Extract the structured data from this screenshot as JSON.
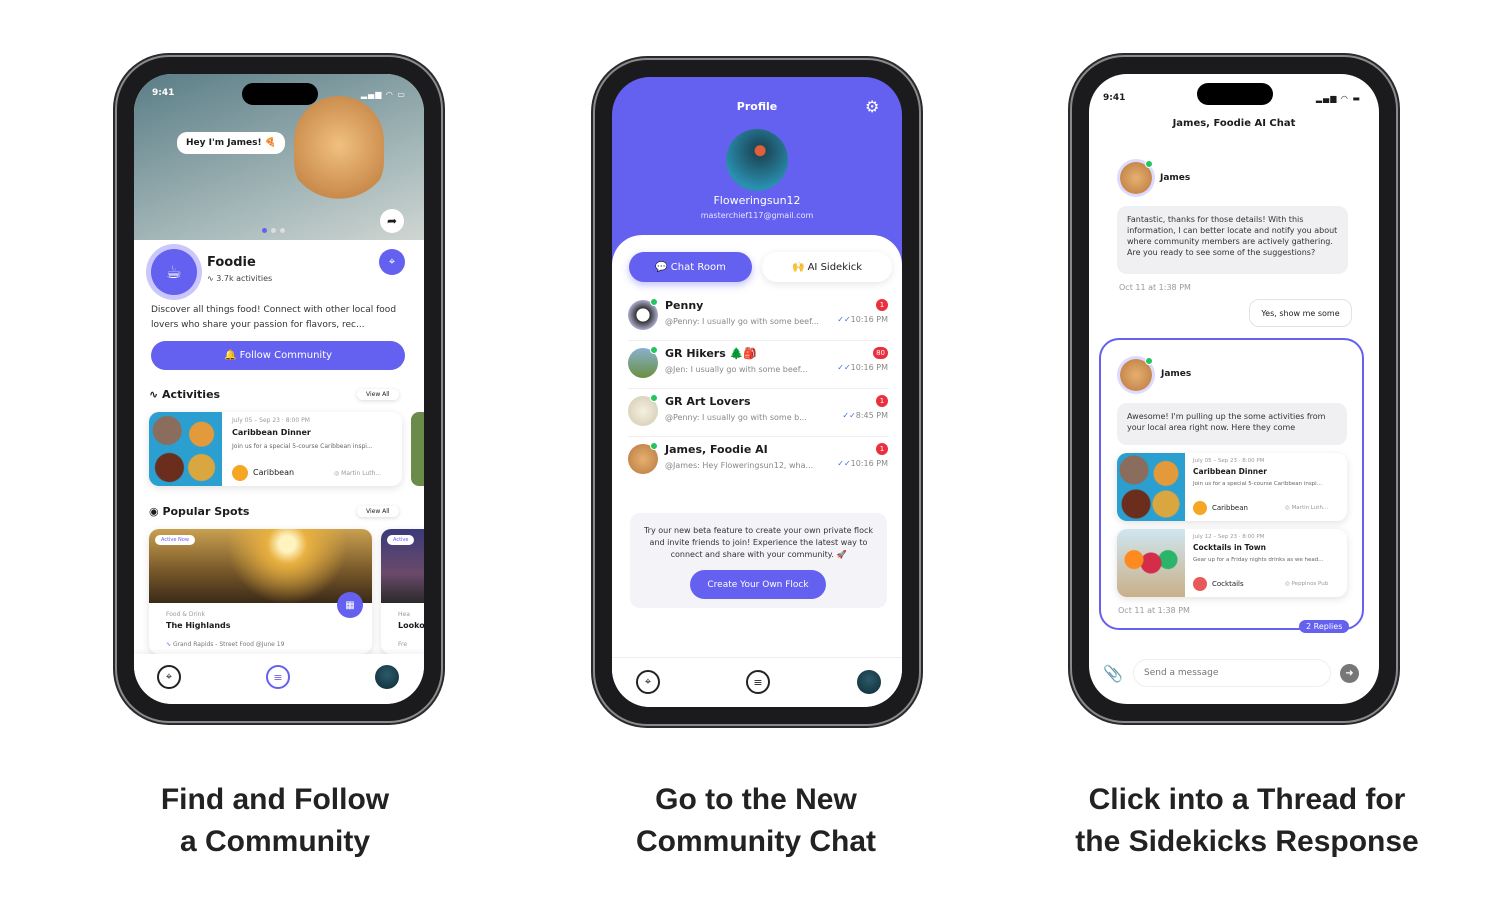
{
  "captions": [
    {
      "line1": "Find and Follow",
      "line2": "a Community"
    },
    {
      "line1": "Go to the New",
      "line2": "Community Chat"
    },
    {
      "line1": "Click into a Thread for",
      "line2": "the Sidekicks Response"
    }
  ],
  "status_time": "9:41",
  "screen1": {
    "greeting": "Hey I'm James! 🍕",
    "community": {
      "name": "Foodie",
      "activities": "3.7k activities",
      "description": "Discover all things food! Connect with other local food lovers who share your passion for flavors, rec..."
    },
    "follow_label": "Follow Community",
    "activities_header": "Activities",
    "view_all": "View All",
    "activity": {
      "dates": "July 05  –  Sep 23 · 8:00 PM",
      "title": "Caribbean Dinner",
      "desc": "Join us for a special 5-course Caribbean inspi...",
      "tag": "Caribbean",
      "location": "Martin Luth..."
    },
    "spots_header": "Popular Spots",
    "spot": {
      "badge": "Active Now",
      "category": "Food & Drink",
      "title": "The Highlands",
      "meta": "Grand Rapids - Street Food @June 19"
    },
    "spot2": {
      "badge": "Active",
      "category": "Hea",
      "title": "Looko",
      "meta": "Fre"
    }
  },
  "screen2": {
    "title": "Profile",
    "username": "Floweringsun12",
    "email": "masterchief117@gmail.com",
    "tabs": [
      "Chat Room",
      "AI Sidekick"
    ],
    "chats": [
      {
        "name": "Penny",
        "preview": "@Penny:  I usually go with some beef...",
        "time": "10:16 PM",
        "unread": "1"
      },
      {
        "name": "GR Hikers 🌲🎒",
        "preview": "@Jen:  I usually go with some beef...",
        "time": "10:16 PM",
        "unread": "80"
      },
      {
        "name": "GR Art Lovers",
        "preview": "@Penny:  I usually go with some b...",
        "time": "8:45 PM",
        "unread": "1"
      },
      {
        "name": "James, Foodie AI",
        "preview": "@James:  Hey Floweringsun12, wha...",
        "time": "10:16 PM",
        "unread": "1"
      }
    ],
    "beta_text": "Try our new beta feature to create your own private flock and invite friends to join! Experience the latest way to connect and share with your community. 🚀",
    "beta_button": "Create Your Own Flock"
  },
  "screen3": {
    "title": "James, Foodie AI Chat",
    "sender": "James",
    "message1": "Fantastic, thanks for those details! With this information, I can better locate and notify you about where community members are actively gathering. Are you ready to see some of the suggestions?",
    "timestamp": "Oct 11 at 1:38 PM",
    "user_reply": "Yes, show me some",
    "message2": "Awesome! I'm pulling up the some activities from your local area right now. Here they come",
    "cards": [
      {
        "dates": "July 05  –  Sep 23 · 8:00 PM",
        "title": "Caribbean Dinner",
        "desc": "Join us for a special 5-course Caribbean inspi...",
        "tag": "Caribbean",
        "location": "Martin Luth..."
      },
      {
        "dates": "July 12  –  Sep 23 · 8:00 PM",
        "title": "Cocktails in Town",
        "desc": "Gear up for a Friday nights drinks as we head...",
        "tag": "Cocktails",
        "location": "Peppinos Pub"
      }
    ],
    "replies": "2 Replies",
    "input_placeholder": "Send a message"
  },
  "colors": {
    "accent": "#6460f0",
    "unread": "#e8303f",
    "online": "#22c55e"
  }
}
